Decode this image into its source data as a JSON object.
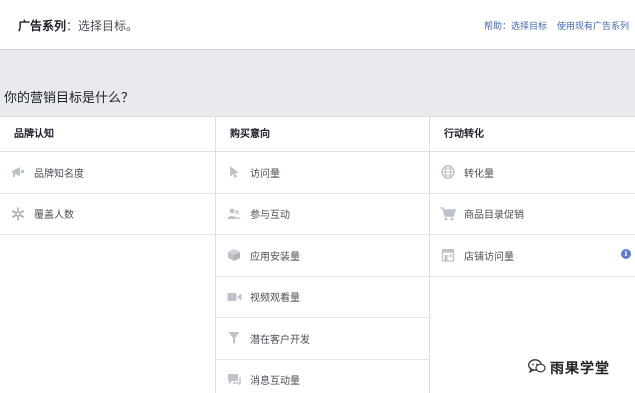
{
  "header": {
    "title_bold": "广告系列",
    "title_rest": "：选择目标。",
    "help_link": "帮助：选择目标",
    "existing_link": "使用现有广告系列"
  },
  "question": "你的营销目标是什么？",
  "columns": [
    {
      "heading": "品牌认知",
      "items": [
        {
          "label": "品牌知名度",
          "icon": "megaphone-icon"
        },
        {
          "label": "覆盖人数",
          "icon": "asterisk-icon"
        }
      ]
    },
    {
      "heading": "购买意向",
      "items": [
        {
          "label": "访问量",
          "icon": "cursor-icon"
        },
        {
          "label": "参与互动",
          "icon": "people-icon"
        },
        {
          "label": "应用安装量",
          "icon": "box-icon"
        },
        {
          "label": "视频观看量",
          "icon": "video-camera-icon"
        },
        {
          "label": "潜在客户开发",
          "icon": "funnel-icon"
        },
        {
          "label": "消息互动量",
          "icon": "chat-icon"
        }
      ]
    },
    {
      "heading": "行动转化",
      "items": [
        {
          "label": "转化量",
          "icon": "globe-icon"
        },
        {
          "label": "商品目录促销",
          "icon": "cart-icon"
        },
        {
          "label": "店铺访问量",
          "icon": "store-icon"
        }
      ]
    }
  ],
  "watermark": "雨果学堂",
  "colors": {
    "link": "#4267b2",
    "icon_gray": "#bec2c9",
    "background": "#e9eaed"
  }
}
